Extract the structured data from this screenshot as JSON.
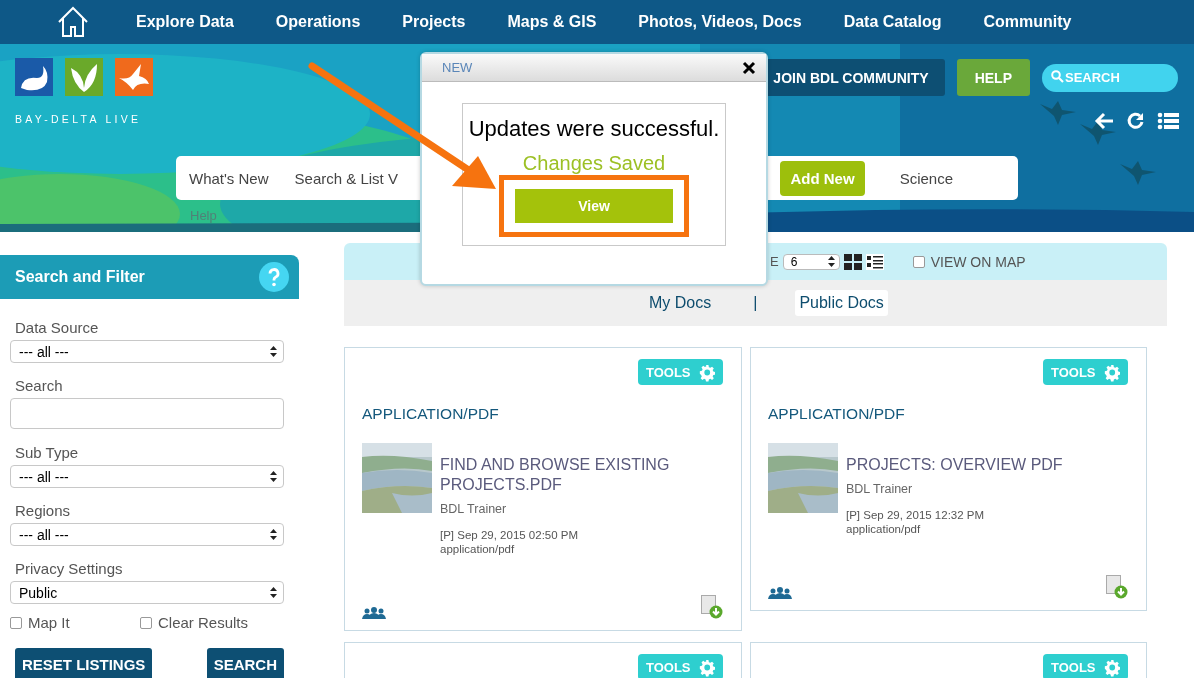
{
  "nav": {
    "items": [
      "Explore Data",
      "Operations",
      "Projects",
      "Maps & GIS",
      "Photos, Videos, Docs",
      "Data Catalog",
      "Community"
    ]
  },
  "banner": {
    "logo_text": "BAY-DELTA LIVE",
    "buttons": [
      {
        "label": "JOIN BDL COMMUNITY",
        "kind": "dark"
      },
      {
        "label": "HELP",
        "kind": "green"
      }
    ],
    "search": {
      "placeholder": "SEARCH"
    },
    "tabs": [
      {
        "label": "What's New",
        "selected": false
      },
      {
        "label": "Search & List V",
        "selected": false
      },
      {
        "label": "Add New",
        "selected": true
      },
      {
        "label": "Science",
        "selected": false
      }
    ],
    "help_link": "Help"
  },
  "sidebar": {
    "title": "Search and Filter",
    "filters": [
      {
        "label": "Data Source",
        "kind": "select",
        "value": "--- all ---"
      },
      {
        "label": "Search",
        "kind": "text"
      },
      {
        "label": "Sub Type",
        "kind": "select",
        "value": "--- all ---"
      },
      {
        "label": "Regions",
        "kind": "select",
        "value": "--- all ---"
      },
      {
        "label": "Privacy Settings",
        "kind": "select",
        "value": "Public"
      }
    ],
    "checkboxes": [
      {
        "label": "Map It",
        "checked": false
      },
      {
        "label": "Clear Results",
        "checked": false
      }
    ],
    "buttons": [
      "RESET LISTINGS",
      "SEARCH"
    ]
  },
  "toolbar": {
    "page_size_label": "E",
    "page_size": "6",
    "view_on_map": {
      "label": "VIEW ON MAP",
      "checked": false
    }
  },
  "doc_tabs": [
    {
      "label": "My Docs",
      "selected": false
    },
    {
      "label": "Public Docs",
      "selected": true
    }
  ],
  "doc_tab_separator": "|",
  "cards": [
    {
      "tools": "TOOLS",
      "type": "APPLICATION/PDF",
      "title": "FIND AND BROWSE EXISTING PROJECTS.PDF",
      "author": "BDL Trainer",
      "date": "[P] Sep 29, 2015 02:50 PM",
      "mime": "application/pdf"
    },
    {
      "tools": "TOOLS",
      "type": "APPLICATION/PDF",
      "title": "PROJECTS: OVERVIEW PDF",
      "author": "BDL Trainer",
      "date": "[P] Sep 29, 2015 12:32 PM",
      "mime": "application/pdf"
    },
    {
      "tools": "TOOLS"
    },
    {
      "tools": "TOOLS"
    }
  ],
  "dialog": {
    "title": "NEW",
    "message": "Updates were successful.",
    "status": "Changes Saved",
    "button": "View"
  }
}
